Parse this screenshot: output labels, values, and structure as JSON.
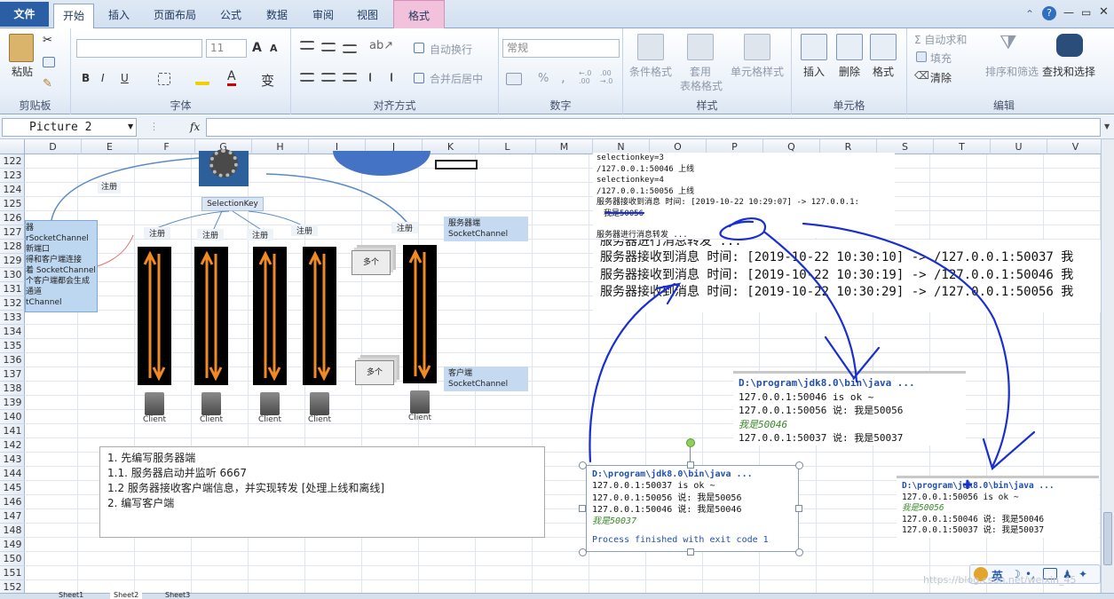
{
  "tabs": {
    "file": "文件",
    "home": "开始",
    "insert": "插入",
    "layout": "页面布局",
    "formulas": "公式",
    "data": "数据",
    "review": "审阅",
    "view": "视图",
    "format": "格式"
  },
  "ribbon": {
    "clipboard": {
      "paste": "粘贴",
      "label": "剪贴板"
    },
    "font": {
      "size": "11",
      "label": "字体",
      "grow": "A",
      "shrink": "A",
      "bold": "B",
      "italic": "I",
      "underline": "U",
      "phonetic": "变"
    },
    "align": {
      "wrap": "自动换行",
      "merge": "合并后居中",
      "label": "对齐方式"
    },
    "number": {
      "format": "常规",
      "pct": "%",
      "comma": ",",
      "inc": ".0\n.00",
      "label": "数字"
    },
    "styles": {
      "cond": "条件格式",
      "table": "套用",
      "table2": "表格格式",
      "cell": "单元格样式",
      "label": "样式"
    },
    "cells": {
      "insert": "插入",
      "delete": "删除",
      "format": "格式",
      "label": "单元格"
    },
    "editing": {
      "autosum": "Σ 自动求和",
      "fill": "填充",
      "clear": "清除",
      "sort": "排序和筛选",
      "find": "查找和选择",
      "label": "编辑"
    }
  },
  "formula_bar": {
    "name_box": "Picture 2",
    "fx": "fx",
    "value": ""
  },
  "columns": [
    "D",
    "E",
    "F",
    "G",
    "H",
    "I",
    "J",
    "K",
    "L",
    "M",
    "N",
    "O",
    "P",
    "Q",
    "R",
    "S",
    "T",
    "U",
    "V"
  ],
  "rows": [
    "122",
    "123",
    "124",
    "125",
    "126",
    "127",
    "128",
    "129",
    "130",
    "131",
    "132",
    "133",
    "134",
    "135",
    "136",
    "137",
    "138",
    "139",
    "140",
    "141",
    "142",
    "143",
    "144",
    "145",
    "146",
    "147",
    "148",
    "149",
    "150",
    "151",
    "152"
  ],
  "diagram": {
    "register": "注册",
    "selection_key": "SelectionKey",
    "server_end": "服务器端",
    "server_channel": "SocketChannel",
    "client_end": "客户端",
    "client_channel": "SocketChannel",
    "many": "多个",
    "client": "Client",
    "left_box": [
      "器",
      "rSocketChannel",
      "新端口",
      "得和客户端连接",
      "着 SocketChannel",
      "个客户端都会生成",
      "通道",
      "tChannel"
    ]
  },
  "notes": [
    "1. 先编写服务器端",
    "1.1. 服务器启动并监听 6667",
    "1.2  服务器接收客户端信息，并实现转发 [处理上线和离线]",
    "2. 编写客户端"
  ],
  "server_small": [
    "selectionkey=3",
    "/127.0.0.1:50046 上线",
    "selectionkey=4",
    "/127.0.0.1:50056 上线",
    "服务器接收到消息 时间: [2019-10-22 10:29:07] -> 127.0.0.1:",
    "我是50056",
    "",
    "服务器进行消息转发 ..."
  ],
  "server_large": [
    "服务器进行消息转发 ...",
    "服务器接收到消息 时间: [2019-10-22 10:30:10] -> /127.0.0.1:50037 我",
    "服务器接收到消息 时间: [2019-10-22 10:30:19] -> /127.0.0.1:50046 我",
    "服务器接收到消息 时间: [2019-10-22 10:30:29] -> /127.0.0.1:50056 我"
  ],
  "console_a": {
    "header": "D:\\program\\jdk8.0\\bin\\java ...",
    "lines": [
      "127.0.0.1:50046 is ok ~",
      "127.0.0.1:50056 说: 我是50056"
    ],
    "me": "我是50046",
    "after": "127.0.0.1:50037 说: 我是50037"
  },
  "console_b": {
    "header": "D:\\program\\jdk8.0\\bin\\java ...",
    "lines": [
      "127.0.0.1:50037 is ok ~",
      "127.0.0.1:50056 说: 我是50056",
      "127.0.0.1:50046 说: 我是50046"
    ],
    "me": "我是50037",
    "finish": "Process finished with exit code 1"
  },
  "console_c": {
    "header": "D:\\program\\jdk8.0\\bin\\java ...",
    "lines": [
      "127.0.0.1:50056 is ok ~"
    ],
    "me": "我是50056",
    "after": [
      "127.0.0.1:50046 说: 我是50046",
      "127.0.0.1:50037 说: 我是50037"
    ]
  },
  "sheets": [
    "Sheet1",
    "Sheet2",
    "Sheet3"
  ],
  "ime": "英",
  "watermark": "https://blog.csdn.net/weixin_45"
}
